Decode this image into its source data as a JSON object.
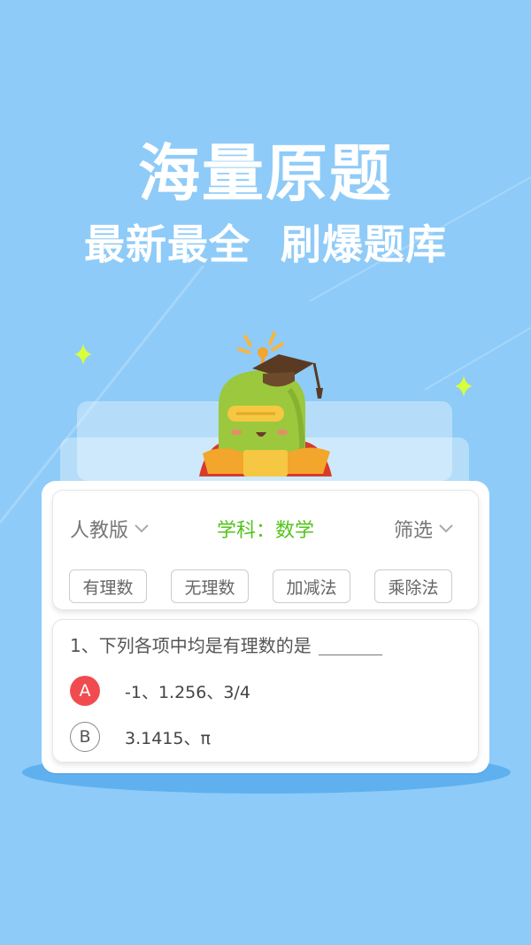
{
  "promo": {
    "headline": "海量原题",
    "subline": "最新最全  刷爆题库"
  },
  "filters": {
    "edition": "人教版",
    "subject": "学科：数学",
    "filter": "筛选"
  },
  "tags": [
    "有理数",
    "无理数",
    "加减法",
    "乘除法"
  ],
  "question": {
    "text": "1、下列各项中均是有理数的是",
    "options": [
      {
        "letter": "A",
        "text": "-1、1.256、3/4",
        "selected": true
      },
      {
        "letter": "B",
        "text": "3.1415、π",
        "selected": false
      }
    ]
  },
  "colors": {
    "background": "#8ecbf8",
    "subject_green": "#52c41a",
    "selected_red": "#f04c4f",
    "mascot_green": "#9bc83c",
    "sparkle": "#d9ff3b"
  },
  "icons": {
    "edition_dropdown": "chevron-down-icon",
    "filter_dropdown": "chevron-down-icon",
    "mascot": "graduation-mascot-illustration"
  }
}
